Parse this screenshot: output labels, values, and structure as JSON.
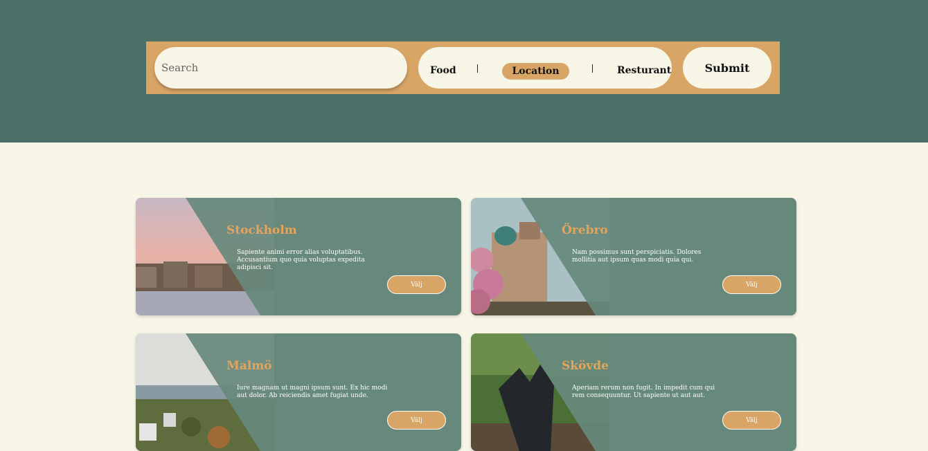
{
  "search": {
    "placeholder": "Search",
    "filters": [
      "Food",
      "Location",
      "Resturant"
    ],
    "active_filter": "Location",
    "submit_label": "Submit"
  },
  "cards": [
    {
      "title": "Stockholm",
      "text": "Sapiente animi error alias voluptatibus. Accusantium quo quia voluptas expedita adipisci sit.",
      "button": "Välj"
    },
    {
      "title": "Örebro",
      "text": "Nam possimus sunt perspiciatis. Dolores mollitia aut ipsum quas modi quia qui.",
      "button": "Välj"
    },
    {
      "title": "Malmö",
      "text": "Iure magnam ut magni ipsum sunt. Ex hic modi aut dolor. Ab reiciendis amet fugiat unde.",
      "button": "Välj"
    },
    {
      "title": "Skövde",
      "text": "Aperiam rerum non fugit. In impedit cum qui rem consequuntur. Ut sapiente ut aut aut.",
      "button": "Välj"
    }
  ],
  "colors": {
    "hero_bg": "#4a7068",
    "accent": "#d9a566",
    "card_bg": "#67897c",
    "page_bg": "#f7f5e6"
  }
}
